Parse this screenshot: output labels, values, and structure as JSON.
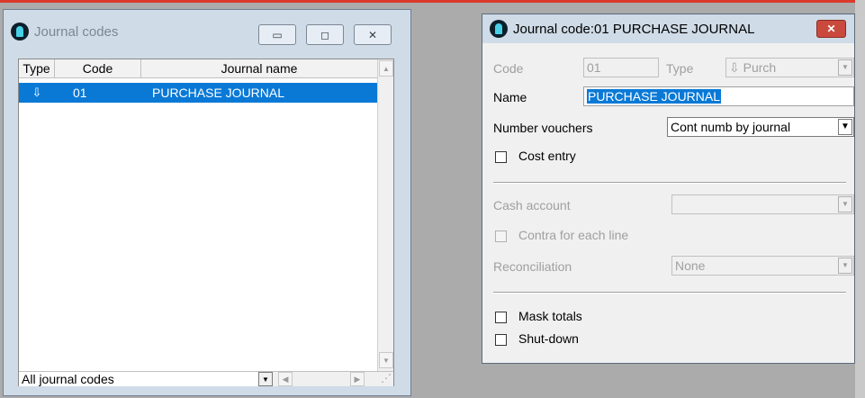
{
  "colors": {
    "selection": "#0a79d6",
    "accent_line": "#d93a2b",
    "close_button": "#c94a3d"
  },
  "list_window": {
    "title": "Journal codes",
    "controls": {
      "minimize": "▭",
      "maximize": "◻",
      "close": "✕"
    },
    "columns": [
      "Type",
      "Code",
      "Journal name"
    ],
    "rows": [
      {
        "type_icon": "purchase-type-icon",
        "type_glyph": "⇩",
        "code": "01",
        "name": "PURCHASE JOURNAL",
        "selected": true
      }
    ],
    "filter": {
      "value": "All journal codes"
    }
  },
  "detail_window": {
    "title": "Journal code:01 PURCHASE JOURNAL",
    "close_glyph": "✕",
    "code_label": "Code",
    "code_value": "01",
    "type_label": "Type",
    "type_value": "Purch",
    "type_glyph": "⇩",
    "name_label": "Name",
    "name_value": "PURCHASE JOURNAL",
    "number_vouchers_label": "Number vouchers",
    "number_vouchers_value": "Cont numb by journal",
    "cost_entry_label": "Cost entry",
    "cost_entry_checked": false,
    "cash_account_label": "Cash account",
    "cash_account_value": "",
    "contra_label": "Contra for each line",
    "contra_checked": false,
    "reconciliation_label": "Reconciliation",
    "reconciliation_value": "None",
    "mask_totals_label": "Mask totals",
    "mask_totals_checked": false,
    "shutdown_label": "Shut-down",
    "shutdown_checked": false
  }
}
